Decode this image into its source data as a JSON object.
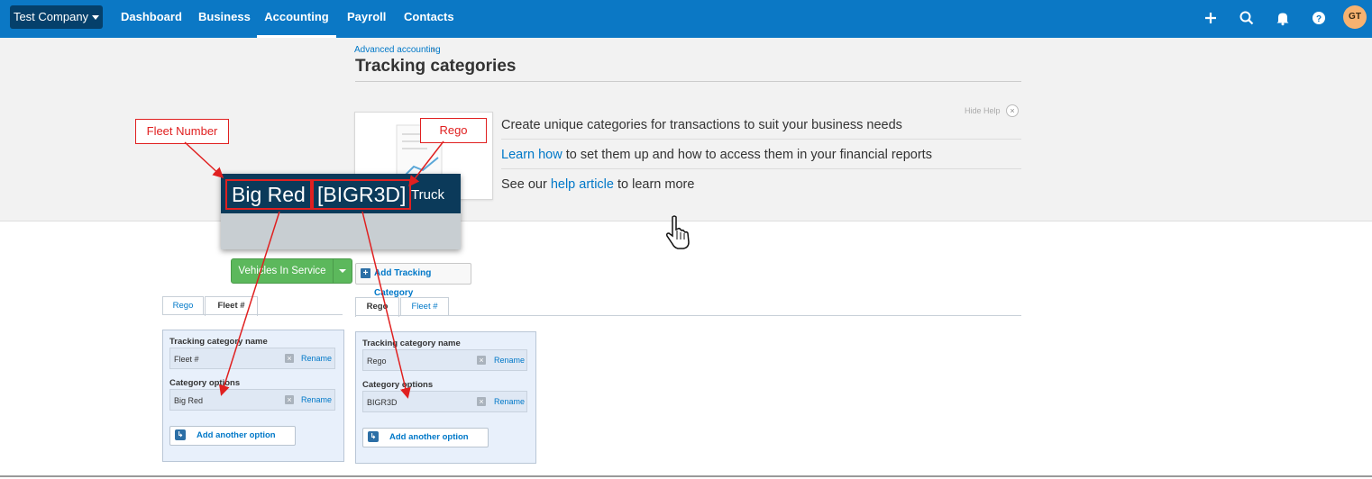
{
  "topbar": {
    "org_name": "Test Company",
    "nav": [
      {
        "label": "Dashboard"
      },
      {
        "label": "Business"
      },
      {
        "label": "Accounting",
        "active": true
      },
      {
        "label": "Payroll"
      },
      {
        "label": "Contacts"
      }
    ],
    "icons": [
      "plus-icon",
      "search-icon",
      "bell-icon",
      "help-icon"
    ],
    "avatar_initials": "GT"
  },
  "page": {
    "breadcrumb": "Advanced accounting",
    "breadcrumb_sep": "›",
    "title": "Tracking categories"
  },
  "help": {
    "hide_label": "Hide Help",
    "hide_x": "×",
    "line1": "Create unique categories for transactions to suit your business needs",
    "line2_link": "Learn how",
    "line2_rest": " to set them up and how to access them in your financial reports",
    "line3_pre": "See our ",
    "line3_link": "help article",
    "line3_post": " to learn more"
  },
  "annotation": {
    "fleet_callout": "Fleet Number",
    "rego_callout": "Rego",
    "popup_fleet": "Big Red",
    "popup_rego": "[BIGR3D]",
    "popup_type": "Truck",
    "popup_button": "Vehicles In Service"
  },
  "add_category_label": "Add Tracking Category",
  "left_panel": {
    "tabs": [
      "Rego",
      "Fleet #"
    ],
    "active_tab": "Fleet #",
    "name_label": "Tracking category name",
    "name_value": "Fleet #",
    "rename": "Rename",
    "options_label": "Category options",
    "option_value": "Big Red",
    "add_option": "Add another option"
  },
  "right_panel": {
    "tabs": [
      "Rego",
      "Fleet #"
    ],
    "active_tab": "Rego",
    "name_label": "Tracking category name",
    "name_value": "Rego",
    "rename": "Rename",
    "options_label": "Category options",
    "option_value": "BIGR3D",
    "add_option": "Add another option"
  },
  "colors": {
    "nav_bg": "#0b78c5",
    "org_button": "#05406b",
    "link": "#0078c8",
    "annotation_red": "#e02020",
    "popup_head": "#0b3a5a",
    "green_button": "#5cb85c",
    "avatar": "#f7b270"
  }
}
